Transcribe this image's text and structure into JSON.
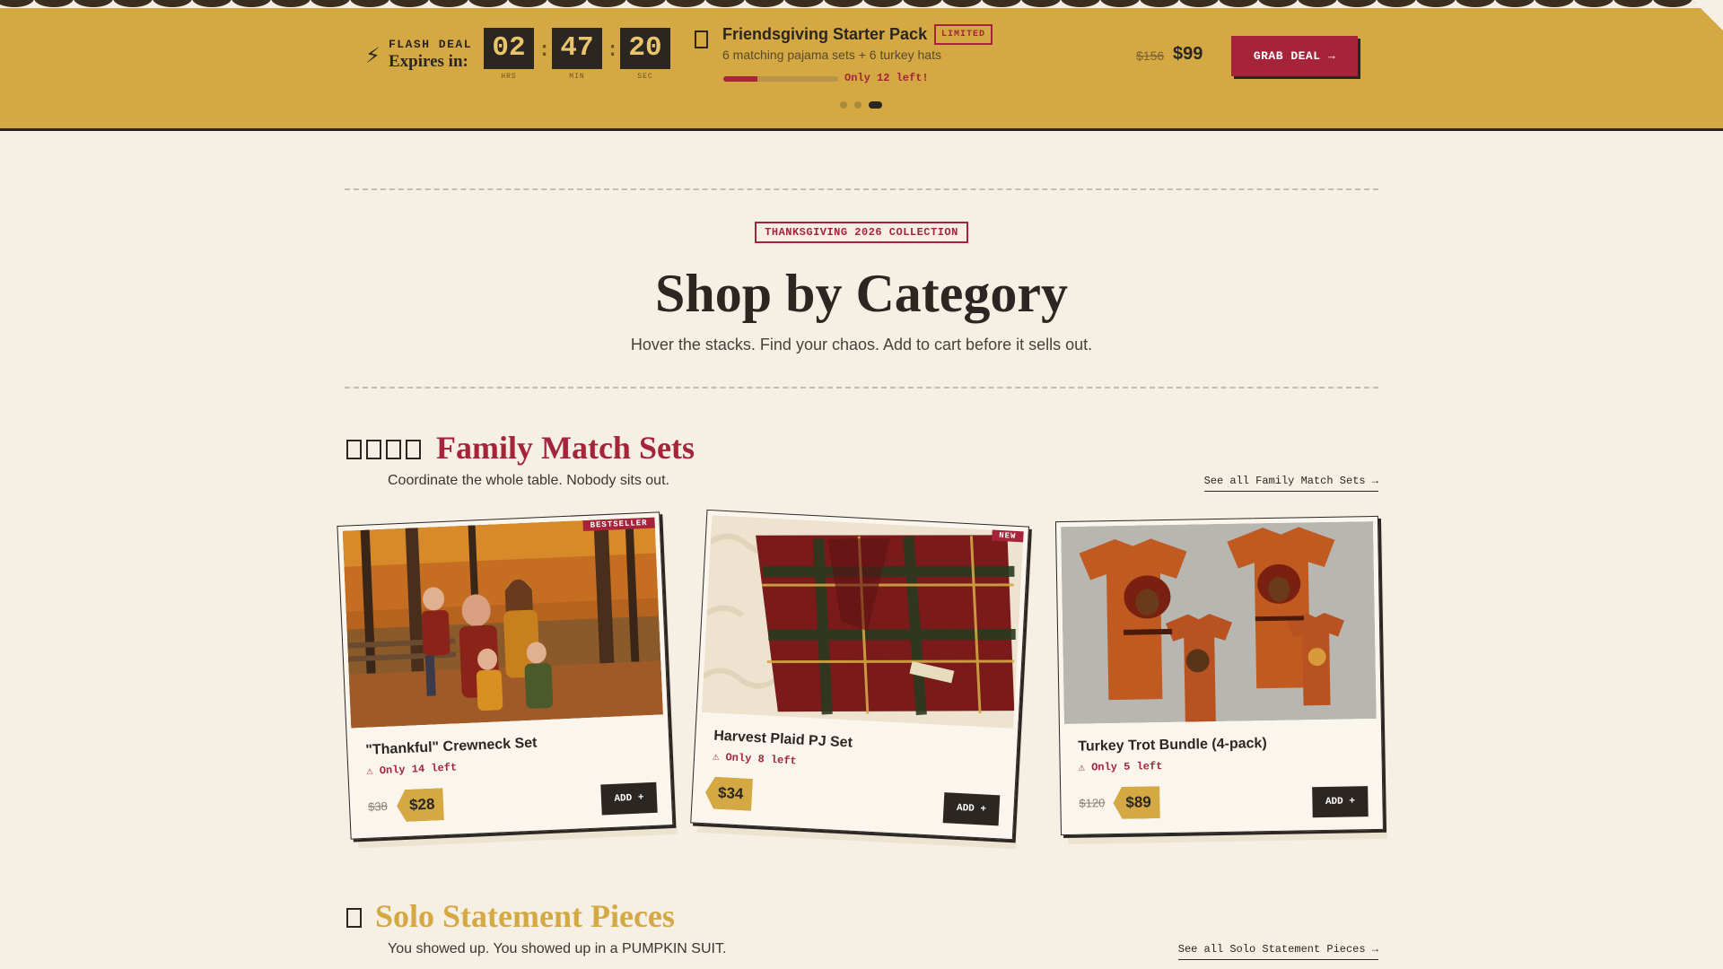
{
  "flash_deal": {
    "label": "FLASH DEAL",
    "expires_label": "Expires in:",
    "timer": [
      {
        "value": "02",
        "unit": "HRS"
      },
      {
        "value": "47",
        "unit": "MIN"
      },
      {
        "value": "20",
        "unit": "SEC"
      }
    ],
    "timer_separator": ":",
    "deal": {
      "title": "Friendsgiving Starter Pack",
      "badge": "LIMITED",
      "subtitle": "6 matching pajama sets + 6 turkey hats",
      "stock_text": "Only 12 left!",
      "stock_fraction": 0.3,
      "old_price": "$156",
      "new_price": "$99",
      "cta": "GRAB DEAL →"
    },
    "carousel": {
      "count": 3,
      "active_index": 2
    }
  },
  "header": {
    "collection_badge": "THANKSGIVING 2026 COLLECTION",
    "title": "Shop by Category",
    "subtitle": "Hover the stacks. Find your chaos. Add to cart before it sells out."
  },
  "sections": [
    {
      "title": "Family Match Sets",
      "subtitle": "Coordinate the whole table. Nobody sits out.",
      "see_all": "See all Family Match Sets →",
      "title_color": "#a6243a",
      "products": [
        {
          "name": "\"Thankful\" Crewneck Set",
          "stock": "⚠ Only 14 left",
          "old_price": "$38",
          "price": "$28",
          "ribbon": "BESTSELLER",
          "add": "ADD +"
        },
        {
          "name": "Harvest Plaid PJ Set",
          "stock": "⚠ Only 8 left",
          "old_price": "",
          "price": "$34",
          "ribbon": "NEW",
          "add": "ADD +"
        },
        {
          "name": "Turkey Trot Bundle (4-pack)",
          "stock": "⚠ Only 5 left",
          "old_price": "$120",
          "price": "$89",
          "ribbon": "",
          "add": "ADD +"
        }
      ]
    },
    {
      "title": "Solo Statement Pieces",
      "subtitle": "You showed up. You showed up in a PUMPKIN SUIT.",
      "see_all": "See all Solo Statement Pieces →",
      "title_color": "#d4a843"
    }
  ],
  "colors": {
    "background": "#f5efe4",
    "gold": "#d4a843",
    "cranberry": "#a6243a",
    "ink": "#2b2622"
  },
  "icons": [
    "lightning-icon",
    "gift-icon",
    "family-icons",
    "person-icon",
    "warning-icon"
  ]
}
